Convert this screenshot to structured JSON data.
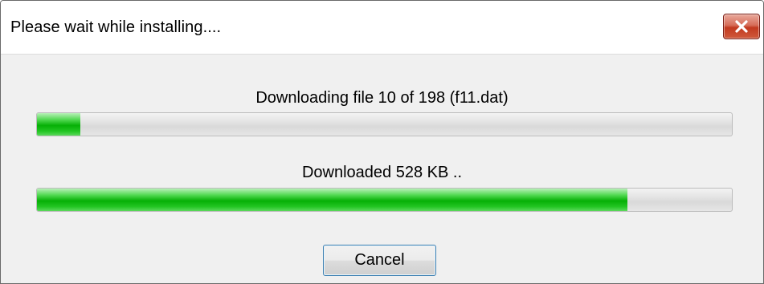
{
  "window": {
    "title": "Please wait while installing....",
    "close_icon": "close-icon"
  },
  "file_progress": {
    "label": "Downloading file 10 of 198 (f11.dat)",
    "fraction": 0.062
  },
  "download_progress": {
    "label": "Downloaded 528 KB ..",
    "fraction": 0.85
  },
  "actions": {
    "cancel_label": "Cancel"
  },
  "colors": {
    "progress_green": "#06b006",
    "close_red": "#c23a20",
    "dialog_background": "#f0f0f0"
  }
}
